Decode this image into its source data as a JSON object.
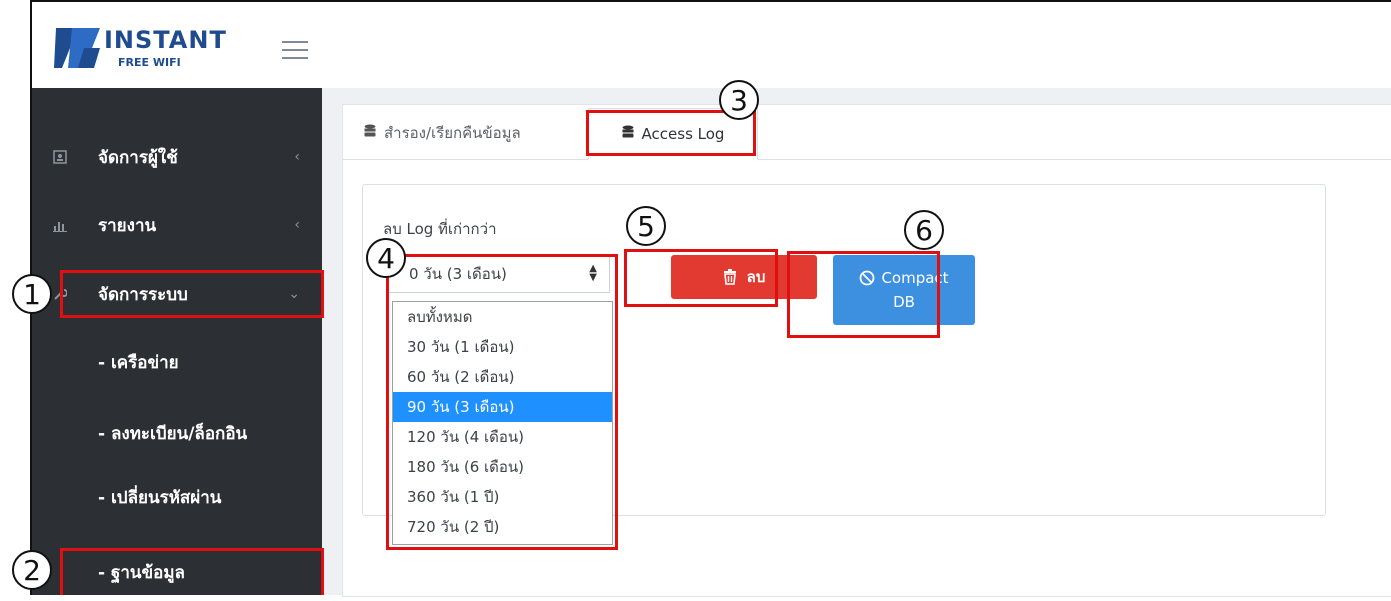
{
  "header": {
    "logo_name": "INSTANT",
    "logo_sub": "FREE WIFI",
    "colors": {
      "logo": "#1f4b8f",
      "sidebar": "#2c3035"
    }
  },
  "sidebar": {
    "items": [
      {
        "label": "จัดการผู้ใช้",
        "icon": "user-card-icon"
      },
      {
        "label": "รายงาน",
        "icon": "bar-chart-icon"
      },
      {
        "label": "จัดการระบบ",
        "icon": "wrench-icon"
      }
    ],
    "subitems": [
      {
        "label": "- เครือข่าย"
      },
      {
        "label": "- ลงทะเบียน/ล็อกอิน"
      },
      {
        "label": "- เปลี่ยนรหัสผ่าน"
      },
      {
        "label": "- ฐานข้อมูล"
      }
    ]
  },
  "tabs": [
    {
      "label": "สำรอง/เรียกคืนข้อมูล",
      "icon": "database-icon"
    },
    {
      "label": "Access Log",
      "icon": "database-icon"
    }
  ],
  "log": {
    "label": "ลบ Log ที่เก่ากว่า",
    "selected": "0 วัน (3 เดือน)",
    "options": [
      "ลบทั้งหมด",
      "30 วัน (1 เดือน)",
      "60 วัน (2 เดือน)",
      "90 วัน (3 เดือน)",
      "120 วัน (4 เดือน)",
      "180 วัน (6 เดือน)",
      "360 วัน (1 ปี)",
      "720 วัน (2 ปี)"
    ],
    "selected_index": 3,
    "delete_label": "ลบ",
    "compact_label_1": "Compact",
    "compact_label_2": "DB",
    "colors": {
      "delete": "#e23a30",
      "compact": "#3d8fe0",
      "highlight": "#e01010",
      "selected_option": "#1e90ff"
    }
  },
  "callouts": [
    "1",
    "2",
    "3",
    "4",
    "5",
    "6"
  ]
}
